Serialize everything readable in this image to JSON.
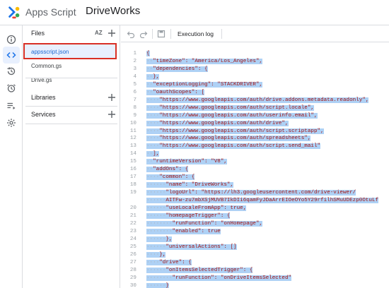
{
  "header": {
    "app_name": "Apps Script",
    "project_title": "DriveWorks"
  },
  "rail": {
    "items": [
      "info-icon",
      "code-icon",
      "history-icon",
      "alarm-icon",
      "executions-icon",
      "settings-icon"
    ],
    "active": "code-icon"
  },
  "files_panel": {
    "heading": "Files",
    "sort_label": "AZ",
    "files": [
      {
        "name": "appsscript.json",
        "selected": true
      },
      {
        "name": "Common.gs",
        "selected": false
      },
      {
        "name": "Drive.gs",
        "selected": false
      }
    ],
    "libraries_label": "Libraries",
    "services_label": "Services"
  },
  "toolbar": {
    "execution_log_label": "Execution log"
  },
  "editor": {
    "lines": [
      {
        "n": "1",
        "t": "{"
      },
      {
        "n": "2",
        "t": "··\"timeZone\": \"America/Los_Angeles\","
      },
      {
        "n": "3",
        "t": "··\"dependencies\": {"
      },
      {
        "n": "4",
        "t": "··},"
      },
      {
        "n": "5",
        "t": "··\"exceptionLogging\": \"STACKDRIVER\","
      },
      {
        "n": "6",
        "t": "··\"oauthScopes\": ["
      },
      {
        "n": "7",
        "t": "····\"https://www.googleapis.com/auth/drive.addons.metadata.readonly\","
      },
      {
        "n": "8",
        "t": "····\"https://www.googleapis.com/auth/script.locale\","
      },
      {
        "n": "9",
        "t": "····\"https://www.googleapis.com/auth/userinfo.email\","
      },
      {
        "n": "10",
        "t": "····\"https://www.googleapis.com/auth/drive\","
      },
      {
        "n": "11",
        "t": "····\"https://www.googleapis.com/auth/script.scriptapp\","
      },
      {
        "n": "12",
        "t": "····\"https://www.googleapis.com/auth/spreadsheets\","
      },
      {
        "n": "13",
        "t": "····\"https://www.googleapis.com/auth/script.send_mail\""
      },
      {
        "n": "14",
        "t": "··],"
      },
      {
        "n": "15",
        "t": "··\"runtimeVersion\": \"V8\","
      },
      {
        "n": "16",
        "t": "··\"addOns\": {"
      },
      {
        "n": "17",
        "t": "····\"common\": {"
      },
      {
        "n": "18",
        "t": "······\"name\": \"DriveWorks\","
      },
      {
        "n": "19",
        "t": "······\"logoUrl\": \"https://lh3.googleusercontent.com/drive-viewer/"
      },
      {
        "n": "",
        "t": "······AITFw-zu7mbXSjMUVB7IkDIi6qamFyJDaArrEIOeOYo5Y29rfilhSMuUDEzp0OtuLf"
      },
      {
        "n": "20",
        "t": "······\"useLocaleFromApp\": true,"
      },
      {
        "n": "21",
        "t": "······\"homepageTrigger\": {"
      },
      {
        "n": "22",
        "t": "········\"runFunction\": \"onHomepage\","
      },
      {
        "n": "23",
        "t": "········\"enabled\": true"
      },
      {
        "n": "24",
        "t": "······},"
      },
      {
        "n": "25",
        "t": "······\"universalActions\": []"
      },
      {
        "n": "26",
        "t": "····},"
      },
      {
        "n": "27",
        "t": "····\"drive\": {"
      },
      {
        "n": "28",
        "t": "······\"onItemsSelectedTrigger\": {"
      },
      {
        "n": "29",
        "t": "········\"runFunction\": \"onDriveItemsSelected\""
      },
      {
        "n": "30",
        "t": "······}"
      }
    ]
  },
  "colors": {
    "selection": "#aed1f5",
    "accent": "#1a73e8",
    "highlight_border": "#d93025"
  }
}
